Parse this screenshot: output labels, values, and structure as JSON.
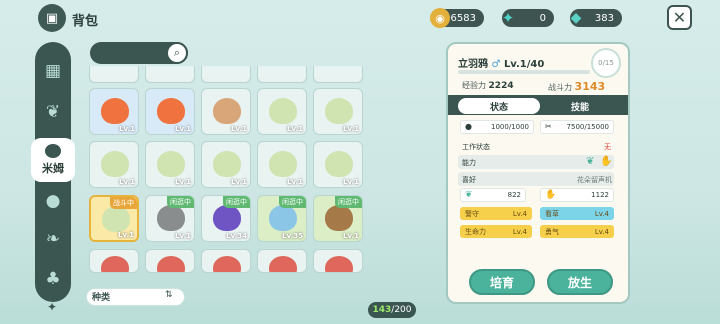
{
  "header": {
    "title": "背包",
    "bag_icon": "bag-icon"
  },
  "currencies": [
    {
      "icon": "coin-icon",
      "value": "6583",
      "color": "#e3b03c"
    },
    {
      "icon": "crystal-icon",
      "value": "0",
      "color": "#4fd2c7"
    },
    {
      "icon": "diamond-icon",
      "value": "383",
      "color": "#5bd0c6"
    }
  ],
  "sidebar": {
    "items": [
      {
        "icon": "grid-icon"
      },
      {
        "icon": "sprout-icon"
      },
      {
        "icon": "mim-icon",
        "label": "米姆",
        "active": true
      },
      {
        "icon": "round-face-icon"
      },
      {
        "icon": "leaf-icon"
      },
      {
        "icon": "tree-icon"
      }
    ]
  },
  "grid": {
    "level_label": "Lv.1",
    "tags": {
      "battle": "战斗中",
      "idle": "闲逛中"
    },
    "cells": [
      {
        "pet": "fox",
        "lv": "Lv.1"
      },
      {
        "pet": "fox",
        "lv": "Lv.1"
      },
      {
        "pet": "tiger",
        "lv": "Lv.1"
      },
      {
        "pet": "sprout",
        "lv": "Lv.1"
      },
      {
        "pet": "sprout",
        "lv": "Lv.1"
      },
      {
        "pet": "sprout",
        "lv": "Lv.1"
      },
      {
        "pet": "sprout",
        "lv": "Lv.1"
      },
      {
        "pet": "sprout",
        "lv": "Lv.1"
      },
      {
        "pet": "sprout",
        "lv": "Lv.1"
      },
      {
        "pet": "sprout",
        "lv": "Lv.1"
      },
      {
        "pet": "sprout",
        "lv": "Lv.1",
        "tag": "战斗中",
        "selected": true
      },
      {
        "pet": "raccoon",
        "lv": "Lv.1",
        "tag": "闲逛中"
      },
      {
        "pet": "purple-bird",
        "lv": "Lv.34",
        "tag": "闲逛中"
      },
      {
        "pet": "blue-bunny",
        "lv": "Lv.35",
        "tag": "闲逛中"
      },
      {
        "pet": "hedgehog",
        "lv": "Lv.1",
        "tag": "闲逛中"
      }
    ]
  },
  "sort": {
    "label": "种类"
  },
  "capacity": {
    "current": "143",
    "max": "/200"
  },
  "detail": {
    "name": "立羽鸦",
    "level": "Lv.1/40",
    "progress": "0/15",
    "exp_label": "经验力",
    "exp_value": "2224",
    "power_label": "战斗力",
    "power_value": "3143",
    "tabs": [
      "状态",
      "技能"
    ],
    "stamina": "1000/1000",
    "work": "7500/15000",
    "work_status_label": "工作状态",
    "work_status_value": "无",
    "ability_label": "能力",
    "hobby_label": "喜好",
    "hobby_value": "花朵留声机",
    "pref1": "822",
    "pref2": "1122",
    "traits": [
      {
        "name": "警守",
        "lv": "Lv.4",
        "color": "yel"
      },
      {
        "name": "看草",
        "lv": "Lv.4",
        "color": "blu"
      },
      {
        "name": "生命力",
        "lv": "Lv.4",
        "color": "yel"
      },
      {
        "name": "勇气",
        "lv": "Lv.4",
        "color": "yel"
      }
    ],
    "buttons": {
      "cultivate": "培育",
      "release": "放生"
    }
  }
}
